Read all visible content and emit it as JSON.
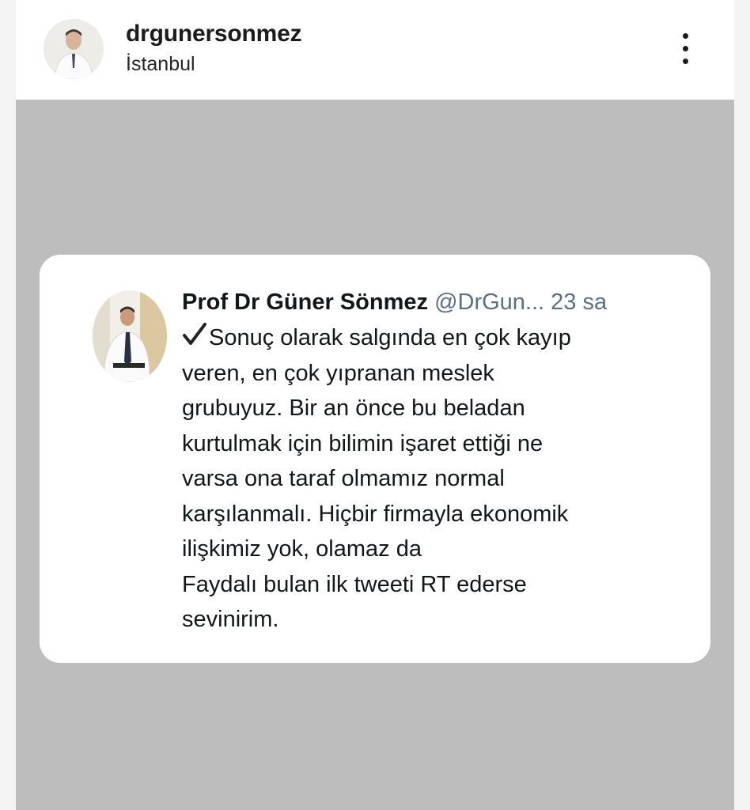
{
  "header": {
    "username": "drgunersonmez",
    "location": "İstanbul",
    "more_icon": "more-vertical-icon"
  },
  "tweet": {
    "author_name": "Prof Dr Güner Sönmez",
    "author_handle": "@DrGun...",
    "time": "23 sa",
    "check_icon": "check-mark-icon",
    "lines": [
      "Sonuç olarak salgında en çok kayıp",
      "veren, en çok yıpranan meslek",
      "grubuyuz. Bir an önce bu beladan",
      "kurtulmak için bilimin işaret ettiği ne",
      "varsa ona taraf olmamız normal",
      "karşılanmalı. Hiçbir firmayla ekonomik",
      "ilişkimiz yok, olamaz da",
      "Faydalı bulan ilk tweeti RT ederse",
      "sevinirim."
    ]
  },
  "colors": {
    "story_background": "#bdbdbd",
    "card_background": "#ffffff",
    "handle_gray": "#5b7083"
  }
}
